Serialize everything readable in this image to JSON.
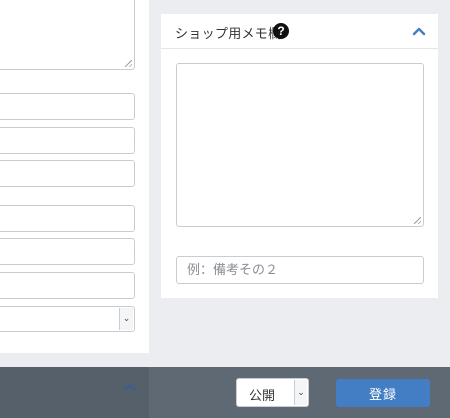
{
  "memo_card": {
    "title": "ショップ用メモ欄",
    "help_icon_glyph": "?",
    "input_placeholder": "例：備考その２"
  },
  "left_panel": {
    "select_caret": "⌄"
  },
  "footer": {
    "status_value": "公開",
    "status_caret": "⌄",
    "register_label": "登録"
  },
  "colors": {
    "accent": "#437ec4",
    "footer_bg": "#5f6974",
    "page_bg": "#ebedf0"
  },
  "icons": [
    "help-icon",
    "chevron-up-icon",
    "chevron-down-icon",
    "resize-grip-icon"
  ]
}
